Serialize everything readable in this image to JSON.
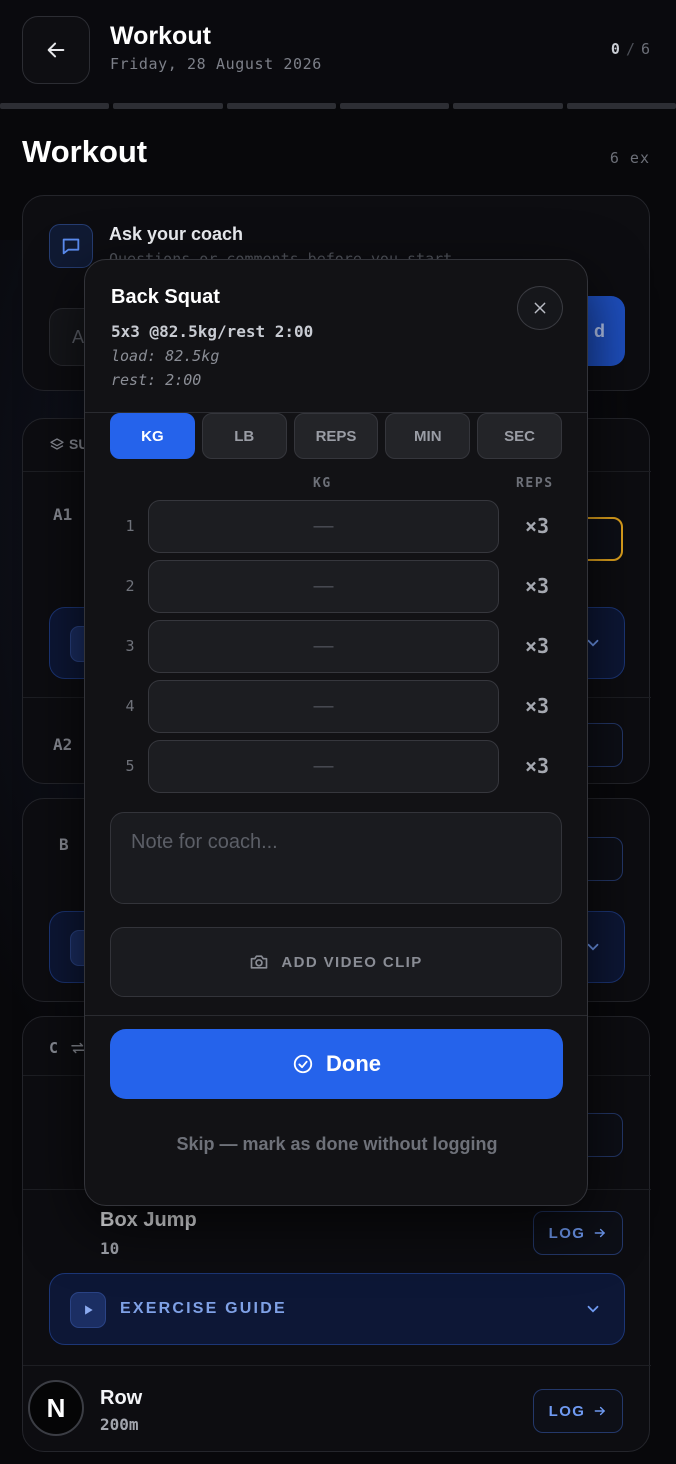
{
  "header": {
    "title": "Workout",
    "date": "Friday, 28 August 2026",
    "progress_done": "0",
    "progress_separator": "/",
    "progress_total": "6",
    "back_icon": "arrow-left-icon"
  },
  "section": {
    "title": "Workout",
    "count": "6 ex"
  },
  "coach": {
    "title": "Ask your coach",
    "subtitle": "Questions or comments before you start",
    "input_placeholder": "A",
    "send_label": "d"
  },
  "blocks": {
    "a_header": "SU",
    "a1_label": "A1",
    "a2_label": "A2",
    "b_label": "B",
    "c_label": "C"
  },
  "exercises": {
    "box_jump": {
      "name": "Box Jump",
      "detail": "10",
      "log_label": "LOG"
    },
    "row": {
      "name": "Row",
      "detail": "200m",
      "log_label": "LOG"
    }
  },
  "guide": {
    "label": "EXERCISE GUIDE"
  },
  "badge": {
    "letter": "N"
  },
  "modal": {
    "title": "Back Squat",
    "prescription": "5x3 @82.5kg/rest 2:00",
    "load_line": "load: 82.5kg",
    "rest_line": "rest: 2:00",
    "units": [
      "KG",
      "LB",
      "REPS",
      "MIN",
      "SEC"
    ],
    "active_unit": "KG",
    "col_weight": "KG",
    "col_reps": "REPS",
    "sets": [
      {
        "num": "1",
        "value": "—",
        "reps": "×3"
      },
      {
        "num": "2",
        "value": "—",
        "reps": "×3"
      },
      {
        "num": "3",
        "value": "—",
        "reps": "×3"
      },
      {
        "num": "4",
        "value": "—",
        "reps": "×3"
      },
      {
        "num": "5",
        "value": "—",
        "reps": "×3"
      }
    ],
    "note_placeholder": "Note for coach...",
    "video_label": "ADD VIDEO CLIP",
    "done_label": "Done",
    "skip_label": "Skip — mark as done without logging"
  },
  "colors": {
    "accent": "#2563eb",
    "background": "#08080b",
    "highlight": "#e3a41d"
  }
}
